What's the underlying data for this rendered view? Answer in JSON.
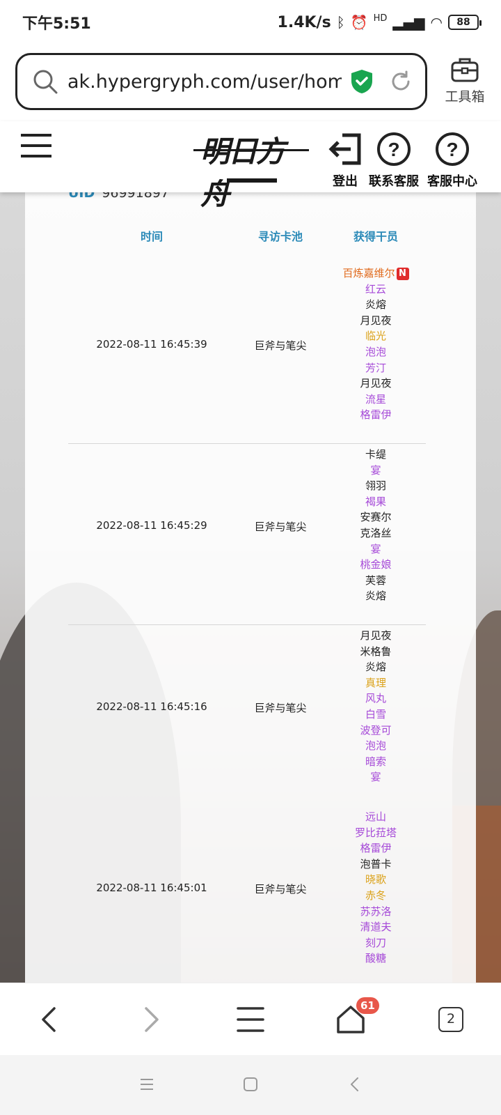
{
  "status_bar": {
    "time": "下午5:51",
    "speed": "1.4K/s",
    "network_label": "HD",
    "battery": "88"
  },
  "browser": {
    "url": "ak.hypergryph.com/user/home",
    "toolbox_label": "工具箱"
  },
  "site_header": {
    "logo_text": "明日方舟",
    "buttons": [
      {
        "label": "登出"
      },
      {
        "label": "联系客服"
      },
      {
        "label": "客服中心"
      }
    ]
  },
  "uid": {
    "label": "UID",
    "value": "96991897"
  },
  "table": {
    "headers": [
      "时间",
      "寻访卡池",
      "获得干员"
    ],
    "rows": [
      {
        "time": "2022-08-11 16:45:39",
        "pool": "巨斧与笔尖",
        "operators": [
          {
            "name": "百炼嘉维尔",
            "rarity": "6",
            "badge": "N"
          },
          {
            "name": "红云",
            "rarity": "4"
          },
          {
            "name": "炎熔",
            "rarity": "3"
          },
          {
            "name": "月见夜",
            "rarity": "3"
          },
          {
            "name": "临光",
            "rarity": "5"
          },
          {
            "name": "泡泡",
            "rarity": "4"
          },
          {
            "name": "芳汀",
            "rarity": "4"
          },
          {
            "name": "月见夜",
            "rarity": "3"
          },
          {
            "name": "流星",
            "rarity": "4"
          },
          {
            "name": "格雷伊",
            "rarity": "4"
          }
        ]
      },
      {
        "time": "2022-08-11 16:45:29",
        "pool": "巨斧与笔尖",
        "operators": [
          {
            "name": "卡缇",
            "rarity": "3"
          },
          {
            "name": "宴",
            "rarity": "4"
          },
          {
            "name": "翎羽",
            "rarity": "3"
          },
          {
            "name": "褐果",
            "rarity": "4"
          },
          {
            "name": "安赛尔",
            "rarity": "3"
          },
          {
            "name": "克洛丝",
            "rarity": "3"
          },
          {
            "name": "宴",
            "rarity": "4"
          },
          {
            "name": "桃金娘",
            "rarity": "4"
          },
          {
            "name": "芙蓉",
            "rarity": "3"
          },
          {
            "name": "炎熔",
            "rarity": "3"
          }
        ]
      },
      {
        "time": "2022-08-11 16:45:16",
        "pool": "巨斧与笔尖",
        "operators": [
          {
            "name": "月见夜",
            "rarity": "3"
          },
          {
            "name": "米格鲁",
            "rarity": "3"
          },
          {
            "name": "炎熔",
            "rarity": "3"
          },
          {
            "name": "真理",
            "rarity": "5"
          },
          {
            "name": "风丸",
            "rarity": "4"
          },
          {
            "name": "白雪",
            "rarity": "4"
          },
          {
            "name": "波登可",
            "rarity": "4"
          },
          {
            "name": "泡泡",
            "rarity": "4"
          },
          {
            "name": "暗索",
            "rarity": "4"
          },
          {
            "name": "宴",
            "rarity": "4"
          }
        ]
      },
      {
        "time": "2022-08-11 16:45:01",
        "pool": "巨斧与笔尖",
        "operators": [
          {
            "name": "远山",
            "rarity": "4"
          },
          {
            "name": "罗比菈塔",
            "rarity": "4"
          },
          {
            "name": "格雷伊",
            "rarity": "4"
          },
          {
            "name": "泡普卡",
            "rarity": "3"
          },
          {
            "name": "晓歌",
            "rarity": "5"
          },
          {
            "name": "赤冬",
            "rarity": "5"
          },
          {
            "name": "苏苏洛",
            "rarity": "4"
          },
          {
            "name": "清道夫",
            "rarity": "4"
          },
          {
            "name": "刻刀",
            "rarity": "4"
          },
          {
            "name": "酸糖",
            "rarity": "4"
          }
        ]
      }
    ]
  },
  "bottom_nav": {
    "home_badge": "61",
    "tab_count": "2"
  },
  "colors": {
    "accent": "#2b8ab8",
    "rarity6": "#e06a1c",
    "rarity5": "#dba21a",
    "rarity4": "#a64ad8",
    "rarity3": "#222222",
    "shield": "#19a54f"
  }
}
